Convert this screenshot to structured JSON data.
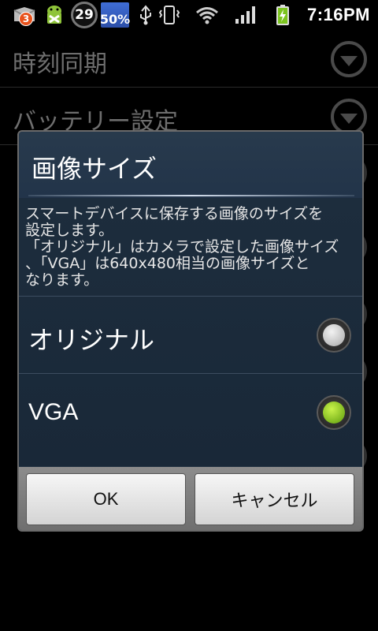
{
  "statusbar": {
    "notification_count": "3",
    "battery_widget": "29",
    "percent_widget": "50%",
    "time": "7:16PM",
    "icons": [
      "gmail-icon",
      "android-icon",
      "usb-icon",
      "vibrate-icon",
      "wifi-icon",
      "signal-icon",
      "battery-charging-icon"
    ]
  },
  "background_list": {
    "items": [
      {
        "label": "時刻同期"
      },
      {
        "label": "バッテリー設定"
      }
    ]
  },
  "dialog": {
    "title": "画像サイズ",
    "message_lines": [
      "スマートデバイスに保存する画像のサイズを",
      "設定します。",
      "「オリジナル」はカメラで設定した画像サイズ",
      "、「VGA」は640x480相当の画像サイズと",
      "なります。"
    ],
    "options": [
      {
        "label": "オリジナル",
        "selected": false
      },
      {
        "label": "VGA",
        "selected": true
      }
    ],
    "ok_label": "OK",
    "cancel_label": "キャンセル"
  },
  "colors": {
    "dialog_bg": "#1f2f3f",
    "radio_selected": "#7cc51f"
  }
}
